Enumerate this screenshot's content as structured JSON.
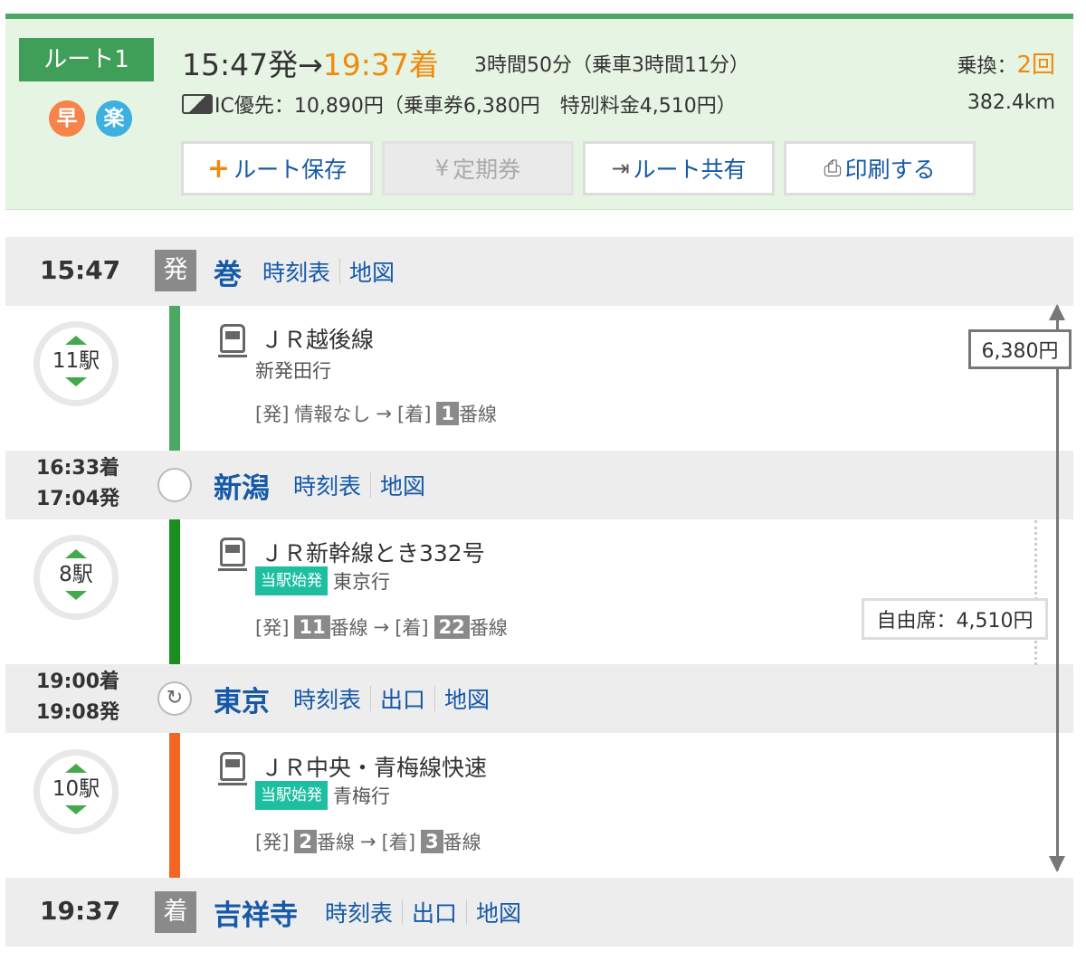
{
  "summary": {
    "route_label": "ルート1",
    "tag_fast": "早",
    "tag_easy": "楽",
    "depart": "15:47発",
    "arrow": "→",
    "arrive": "19:37着",
    "duration": "3時間50分（乗車3時間11分）",
    "transfer_label": "乗換：",
    "transfer_count": "2回",
    "fare": "IC優先：10,890円（乗車券6,380円　特別料金4,510円）",
    "distance": "382.4km",
    "buttons": {
      "save": "ルート保存",
      "commuter": "定期券",
      "share": "ルート共有",
      "print": "印刷する"
    },
    "colors": {
      "accent": "#3f9f58",
      "arrival": "#f08a0c",
      "link": "#1559a8"
    }
  },
  "stations": [
    {
      "time": "15:47",
      "mark": "発",
      "name": "巻",
      "links": [
        "時刻表",
        "地図"
      ]
    },
    {
      "arr": "16:33着",
      "dep": "17:04発",
      "name": "新潟",
      "links": [
        "時刻表",
        "地図"
      ]
    },
    {
      "arr": "19:00着",
      "dep": "19:08発",
      "name": "東京",
      "links": [
        "時刻表",
        "出口",
        "地図"
      ]
    },
    {
      "time": "19:37",
      "mark": "着",
      "name": "吉祥寺",
      "links": [
        "時刻表",
        "出口",
        "地図"
      ]
    }
  ],
  "segments": [
    {
      "stops": "11駅",
      "line": "ＪＲ越後線",
      "badge": "",
      "dest": "新発田行",
      "dep_label": "[発]",
      "dep_text": "情報なし",
      "arrow": "→",
      "arr_label": "[着]",
      "arr_num": "1",
      "track": "番線",
      "color": "#4ea865"
    },
    {
      "stops": "8駅",
      "line": "ＪＲ新幹線とき332号",
      "badge": "当駅始発",
      "dest": "東京行",
      "dep_label": "[発]",
      "dep_num": "11",
      "track": "番線",
      "arrow": "→",
      "arr_label": "[着]",
      "arr_num": "22",
      "color": "#1a8f20"
    },
    {
      "stops": "10駅",
      "line": "ＪＲ中央・青梅線快速",
      "badge": "当駅始発",
      "dest": "青梅行",
      "dep_label": "[発]",
      "dep_num": "2",
      "track": "番線",
      "arrow": "→",
      "arr_label": "[着]",
      "arr_num": "3",
      "color": "#f26522"
    }
  ],
  "fares": {
    "ticket": "6,380円",
    "seat": "自由席：4,510円"
  }
}
